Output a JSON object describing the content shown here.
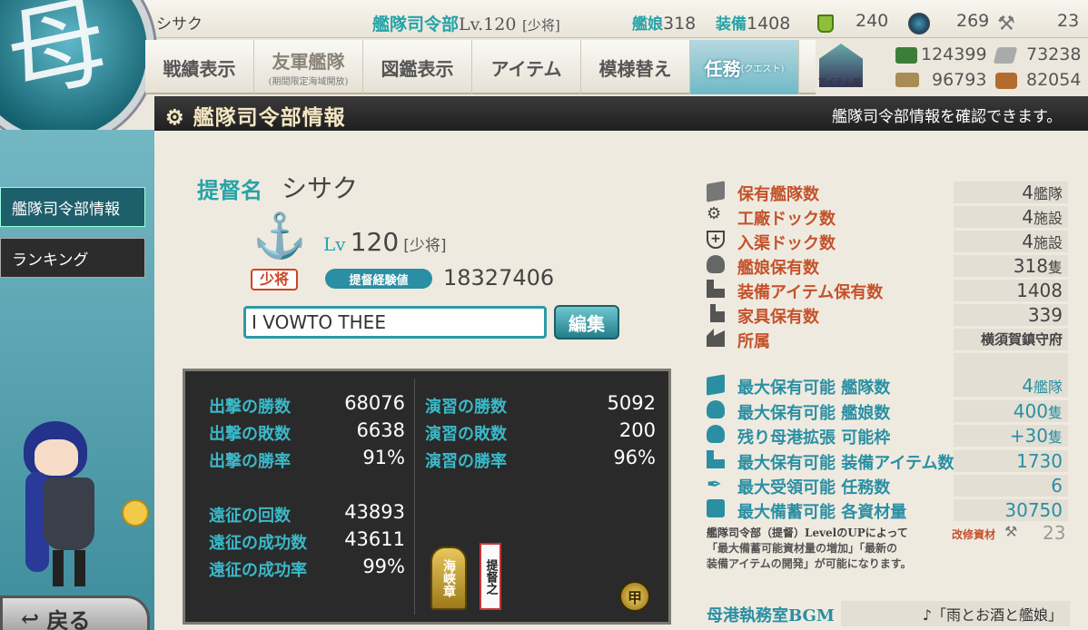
{
  "header": {
    "player_name": "シサク",
    "hq_label": "艦隊司令部",
    "hq_level": "Lv.120",
    "rank": "[少将]",
    "ships_label": "艦娘",
    "ships_count": "318",
    "equip_label": "装備",
    "equip_count": "1408",
    "bucket_count": "240",
    "dev_material_count": "269",
    "improve_material_count": "23"
  },
  "menu": {
    "items": [
      {
        "label": "戦績表示",
        "sub": ""
      },
      {
        "label": "友軍艦隊",
        "sub": "(期間限定海域開放)"
      },
      {
        "label": "図鑑表示",
        "sub": ""
      },
      {
        "label": "アイテム",
        "sub": ""
      },
      {
        "label": "模様替え",
        "sub": ""
      },
      {
        "label": "任務",
        "sub": "(クエスト)"
      }
    ],
    "shop_label": "アイテム屋"
  },
  "resources": {
    "fuel": "124399",
    "ammo": "73238",
    "steel": "96793",
    "bauxite": "82054"
  },
  "title_bar": {
    "title": "艦隊司令部情報",
    "subtitle": "艦隊司令部情報を確認できます。"
  },
  "sidebar": {
    "items": [
      {
        "label": "艦隊司令部情報"
      },
      {
        "label": "ランキング"
      }
    ],
    "back_label": "戻る"
  },
  "profile": {
    "name_label": "提督名",
    "name": "シサク",
    "lv_label": "Lv",
    "level": "120",
    "rank": "[少将]",
    "rank_badge": "少将",
    "exp_label": "提督経験値",
    "exp": "18327406",
    "comment": "I VOWTO THEE",
    "edit_label": "編集"
  },
  "record": {
    "sortie_wins_label": "出撃の勝数",
    "sortie_wins": "68076",
    "sortie_losses_label": "出撃の敗数",
    "sortie_losses": "6638",
    "sortie_rate_label": "出撃の勝率",
    "sortie_rate": "91%",
    "exercise_wins_label": "演習の勝数",
    "exercise_wins": "5092",
    "exercise_losses_label": "演習の敗数",
    "exercise_losses": "200",
    "exercise_rate_label": "演習の勝率",
    "exercise_rate": "96%",
    "expedition_count_label": "遠征の回数",
    "expedition_count": "43893",
    "expedition_success_label": "遠征の成功数",
    "expedition_success": "43611",
    "expedition_rate_label": "遠征の成功率",
    "expedition_rate": "99%",
    "medal_1": "海峡章",
    "medal_2": "提督之",
    "medal_3": "甲"
  },
  "stats": [
    {
      "label": "保有艦隊数",
      "value": "4",
      "unit": "艦隊",
      "icon": "fleet-icon"
    },
    {
      "label": "工廠ドック数",
      "value": "4",
      "unit": "施設",
      "icon": "gear-icon"
    },
    {
      "label": "入渠ドック数",
      "value": "4",
      "unit": "施設",
      "icon": "repair-icon"
    },
    {
      "label": "艦娘保有数",
      "value": "318",
      "unit": "隻",
      "icon": "shipgirl-icon"
    },
    {
      "label": "装備アイテム保有数",
      "value": "1408",
      "unit": "",
      "icon": "equipment-icon"
    },
    {
      "label": "家具保有数",
      "value": "339",
      "unit": "",
      "icon": "furniture-icon"
    },
    {
      "label": "所属",
      "value": "横須賀鎮守府",
      "unit": "",
      "icon": "base-icon"
    }
  ],
  "max_stats": [
    {
      "label": "最大保有可能 艦隊数",
      "value": "4",
      "unit": "艦隊",
      "icon": "fleet-icon"
    },
    {
      "label": "最大保有可能 艦娘数",
      "value": "400",
      "unit": "隻",
      "icon": "shipgirl-icon"
    },
    {
      "label": "残り母港拡張 可能枠",
      "value": "+30",
      "unit": "隻",
      "icon": "port-expand-icon"
    },
    {
      "label": "最大保有可能 装備アイテム数",
      "value": "1730",
      "unit": "",
      "icon": "equipment-icon"
    },
    {
      "label": "最大受領可能 任務数",
      "value": "6",
      "unit": "",
      "icon": "quest-icon"
    },
    {
      "label": "最大備蓄可能 各資材量",
      "value": "30750",
      "unit": "",
      "icon": "storage-icon"
    }
  ],
  "note": {
    "text_1": "艦隊司令部（提督）LevelのUPによって",
    "text_2": "「最大備蓄可能資材量の増加」「最新の",
    "text_3": "装備アイテムの開発」が可能になります。",
    "improve_label": "改修資材",
    "improve_value": "23"
  },
  "bgm": {
    "label": "母港執務室BGM",
    "value": "♪「雨とお酒と艦娘」"
  },
  "colors": {
    "teal": "#27a3a8",
    "orange": "#c4522a",
    "dark": "#2a2a2a"
  }
}
